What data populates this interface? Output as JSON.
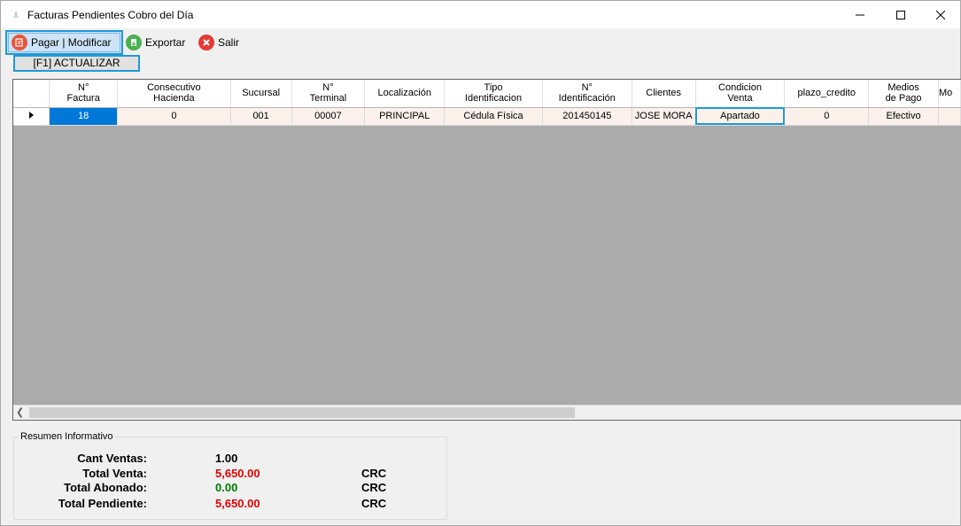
{
  "window": {
    "title": "Facturas Pendientes Cobro del Día"
  },
  "toolbar": {
    "pay_label": "Pagar | Modificar",
    "export_label": "Exportar",
    "exit_label": "Salir",
    "refresh_label": "[F1] ACTUALIZAR"
  },
  "grid": {
    "columns": [
      "N°\nFactura",
      "Consecutivo\nHacienda",
      "Sucursal",
      "N°\nTerminal",
      "Localización",
      "Tipo\nIdentificacion",
      "N°\nIdentificación",
      "Clientes",
      "Condicion\nVenta",
      "plazo_credito",
      "Medios\nde Pago",
      "Mo"
    ],
    "rows": [
      [
        "18",
        "0",
        "001",
        "00007",
        "PRINCIPAL",
        "Cédula Física",
        "201450145",
        "JOSE  MORA",
        "Apartado",
        "0",
        "Efectivo",
        ""
      ]
    ]
  },
  "summary": {
    "legend": "Resumen Informativo",
    "cant_ventas_label": "Cant Ventas:",
    "cant_ventas_value": "1.00",
    "total_venta_label": "Total Venta:",
    "total_venta_value": "5,650.00",
    "total_venta_currency": "CRC",
    "total_abonado_label": "Total Abonado:",
    "total_abonado_value": "0.00",
    "total_abonado_currency": "CRC",
    "total_pendiente_label": "Total Pendiente:",
    "total_pendiente_value": "5,650.00",
    "total_pendiente_currency": "CRC"
  },
  "colors": {
    "accent": "#1f9ad6",
    "selection": "#0078d7",
    "negative": "#e60000",
    "positive": "#008000"
  }
}
